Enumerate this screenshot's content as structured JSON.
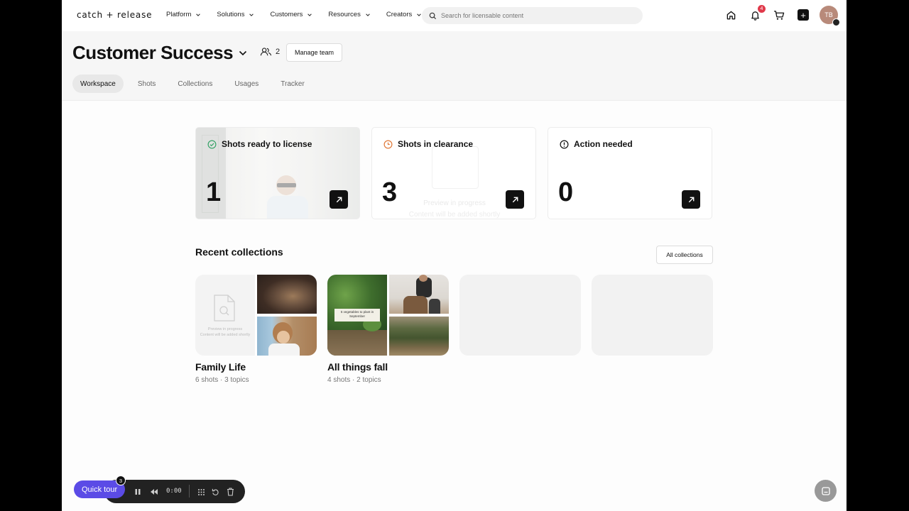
{
  "nav": {
    "logo": "catch + release",
    "menu": [
      "Platform",
      "Solutions",
      "Customers",
      "Resources",
      "Creators"
    ],
    "search_placeholder": "Search for licensable content",
    "notification_count": "4",
    "avatar_initials": "TB"
  },
  "header": {
    "title": "Customer Success",
    "member_count": "2",
    "manage_label": "Manage team",
    "tabs": [
      "Workspace",
      "Shots",
      "Collections",
      "Usages",
      "Tracker"
    ],
    "active_tab": "Workspace"
  },
  "cards": [
    {
      "label": "Shots ready to license",
      "value": "1",
      "icon": "check-circle-icon",
      "color": "#3aa46a"
    },
    {
      "label": "Shots in clearance",
      "value": "3",
      "icon": "clock-icon",
      "color": "#e07a3a",
      "ghost_line1": "Preview in progress",
      "ghost_line2": "Content will be added shortly"
    },
    {
      "label": "Action needed",
      "value": "0",
      "icon": "alert-circle-icon",
      "color": "#111111"
    }
  ],
  "recent": {
    "title": "Recent collections",
    "all_label": "All collections",
    "collections": [
      {
        "name": "Family Life",
        "shots": "6 shots",
        "topics": "3 topics",
        "preview_line1": "Preview in progress",
        "preview_line2": "Content will be added shortly"
      },
      {
        "name": "All things fall",
        "shots": "4 shots",
        "topics": "2 topics",
        "sign_text": "5 vegetables to plant in September"
      }
    ]
  },
  "player": {
    "tour_label": "Quick tour",
    "tour_count": "3",
    "time": "0:00"
  }
}
